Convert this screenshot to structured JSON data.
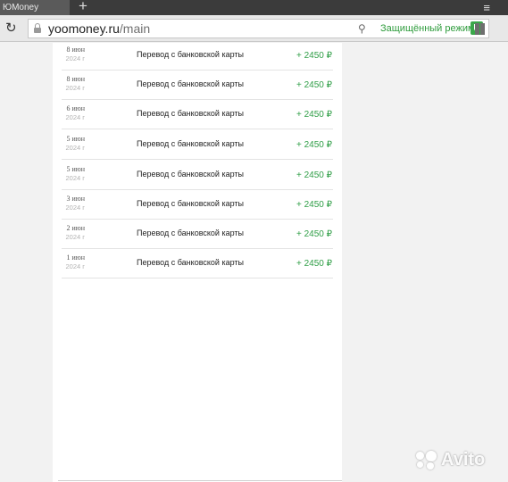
{
  "browser": {
    "tab_title": "ЮMoney",
    "new_tab": "+",
    "menu_icon": "≡",
    "url_domain": "yoomoney.ru",
    "url_path": "/main",
    "protect_mode_label": "Защищённый режим"
  },
  "transactions": [
    {
      "date": "8 июн",
      "year": "2024 г",
      "description": "Перевод с банковской карты",
      "amount": "+ 2450 ₽"
    },
    {
      "date": "8 июн",
      "year": "2024 г",
      "description": "Перевод с банковской карты",
      "amount": "+ 2450 ₽"
    },
    {
      "date": "6 июн",
      "year": "2024 г",
      "description": "Перевод с банковской карты",
      "amount": "+ 2450 ₽"
    },
    {
      "date": "5 июн",
      "year": "2024 г",
      "description": "Перевод с банковской карты",
      "amount": "+ 2450 ₽"
    },
    {
      "date": "5 июн",
      "year": "2024 г",
      "description": "Перевод с банковской карты",
      "amount": "+ 2450 ₽"
    },
    {
      "date": "3 июн",
      "year": "2024 г",
      "description": "Перевод с банковской карты",
      "amount": "+ 2450 ₽"
    },
    {
      "date": "2 июн",
      "year": "2024 г",
      "description": "Перевод с банковской карты",
      "amount": "+ 2450 ₽"
    },
    {
      "date": "1 июн",
      "year": "2024 г",
      "description": "Перевод с банковской карты",
      "amount": "+ 2450 ₽"
    }
  ],
  "colors": {
    "amount_green": "#2f9e46",
    "protect_green": "#2e9c3c"
  },
  "watermark": "Avito"
}
